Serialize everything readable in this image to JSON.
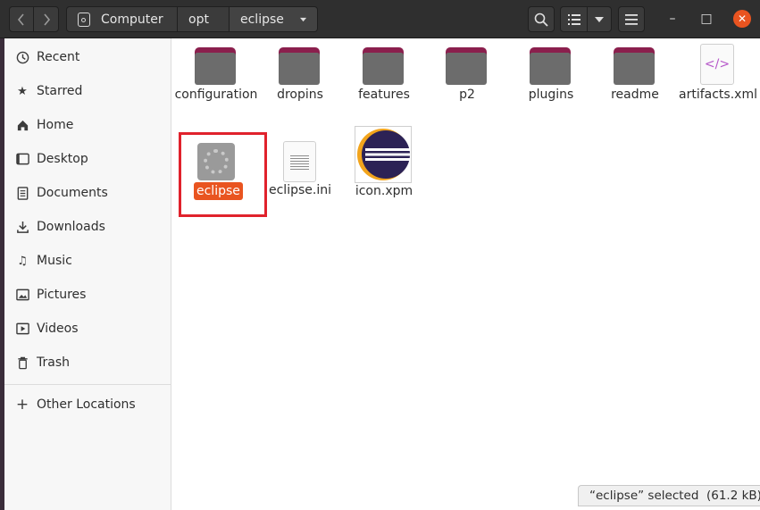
{
  "breadcrumb": [
    "Computer",
    "opt",
    "eclipse"
  ],
  "toolbar": {
    "back_icon": "chevron-left-icon",
    "forward_icon": "chevron-right-icon",
    "search_icon": "search-icon",
    "view_icon": "list-view-icon",
    "menu_icon": "hamburger-menu-icon"
  },
  "window_controls": {
    "minimize": "–",
    "maximize": "□",
    "close": "✕"
  },
  "sidebar": {
    "items": [
      {
        "label": "Recent",
        "icon": "clock-icon"
      },
      {
        "label": "Starred",
        "icon": "star-icon"
      },
      {
        "label": "Home",
        "icon": "home-icon"
      },
      {
        "label": "Desktop",
        "icon": "desktop-icon"
      },
      {
        "label": "Documents",
        "icon": "document-icon"
      },
      {
        "label": "Downloads",
        "icon": "download-icon"
      },
      {
        "label": "Music",
        "icon": "music-icon"
      },
      {
        "label": "Pictures",
        "icon": "picture-icon"
      },
      {
        "label": "Videos",
        "icon": "video-icon"
      },
      {
        "label": "Trash",
        "icon": "trash-icon"
      }
    ],
    "other_locations": "Other Locations"
  },
  "files": [
    {
      "name": "configuration",
      "type": "folder"
    },
    {
      "name": "dropins",
      "type": "folder"
    },
    {
      "name": "features",
      "type": "folder"
    },
    {
      "name": "p2",
      "type": "folder"
    },
    {
      "name": "plugins",
      "type": "folder"
    },
    {
      "name": "readme",
      "type": "folder"
    },
    {
      "name": "artifacts.xml",
      "type": "xml"
    },
    {
      "name": "eclipse",
      "type": "executable",
      "selected": true
    },
    {
      "name": "eclipse.ini",
      "type": "text"
    },
    {
      "name": "icon.xpm",
      "type": "image"
    }
  ],
  "status": "“eclipse” selected  (61.2 kB)",
  "colors": {
    "accent": "#e95420",
    "folder_tab": "#8b1f4d",
    "highlight_box": "#e0222c"
  }
}
